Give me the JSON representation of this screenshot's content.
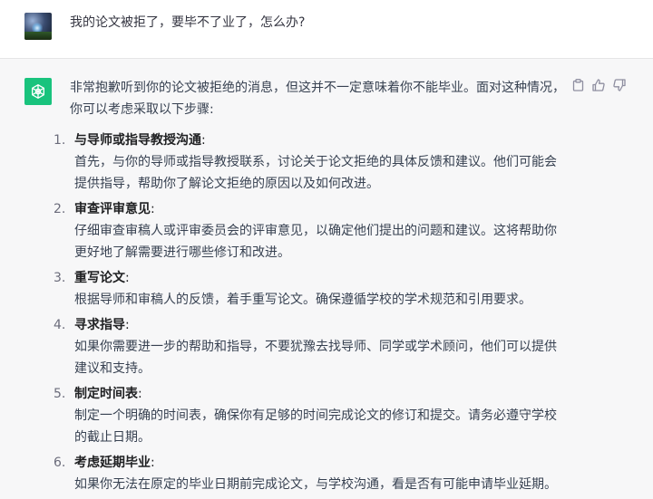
{
  "user": {
    "message": "我的论文被拒了，要毕不了业了，怎么办?"
  },
  "assistant": {
    "intro": "非常抱歉听到你的论文被拒绝的消息，但这并不一定意味着你不能毕业。面对这种情况，你可以考虑采取以下步骤:",
    "steps": [
      {
        "num": "1.",
        "title": "与导师或指导教授沟通",
        "body": "首先，与你的导师或指导教授联系，讨论关于论文拒绝的具体反馈和建议。他们可能会提供指导，帮助你了解论文拒绝的原因以及如何改进。"
      },
      {
        "num": "2.",
        "title": "审查评审意见",
        "body": "仔细审查审稿人或评审委员会的评审意见，以确定他们提出的问题和建议。这将帮助你更好地了解需要进行哪些修订和改进。"
      },
      {
        "num": "3.",
        "title": "重写论文",
        "body": "根据导师和审稿人的反馈，着手重写论文。确保遵循学校的学术规范和引用要求。"
      },
      {
        "num": "4.",
        "title": "寻求指导",
        "body": "如果你需要进一步的帮助和指导，不要犹豫去找导师、同学或学术顾问，他们可以提供建议和支持。"
      },
      {
        "num": "5.",
        "title": "制定时间表",
        "body": "制定一个明确的时间表，确保你有足够的时间完成论文的修订和提交。请务必遵守学校的截止日期。"
      },
      {
        "num": "6.",
        "title": "考虑延期毕业",
        "body": "如果你无法在原定的毕业日期前完成论文，与学校沟通，看是否有可能申请毕业延期。"
      }
    ],
    "colon": ":"
  },
  "icons": {
    "actions": [
      "clipboard-icon",
      "thumbs-up-icon",
      "thumbs-down-icon"
    ],
    "assistant_logo": "openai-logo-icon"
  },
  "colors": {
    "assistant_logo_bg": "#19c37d",
    "assistant_row_bg": "#f7f7f8",
    "user_row_bg": "#ffffff"
  }
}
